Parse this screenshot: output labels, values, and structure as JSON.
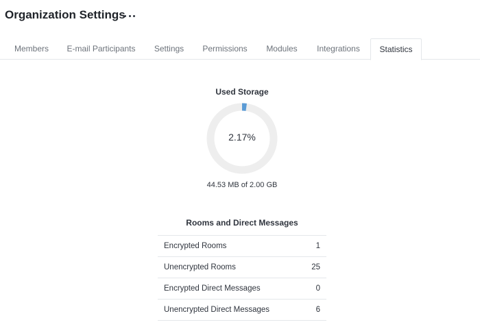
{
  "header": {
    "title": "Organization Settings",
    "more_icon": "more-horizontal-icon"
  },
  "tabs": [
    {
      "label": "Members",
      "active": false
    },
    {
      "label": "E-mail Participants",
      "active": false
    },
    {
      "label": "Settings",
      "active": false
    },
    {
      "label": "Permissions",
      "active": false
    },
    {
      "label": "Modules",
      "active": false
    },
    {
      "label": "Integrations",
      "active": false
    },
    {
      "label": "Statistics",
      "active": true
    }
  ],
  "storage": {
    "title": "Used Storage",
    "percent_label": "2.17%",
    "percent": 2.17,
    "caption": "44.53 MB of 2.00 GB",
    "colors": {
      "track": "#eeeeee",
      "fill": "#5b9bd5"
    }
  },
  "rooms": {
    "title": "Rooms and Direct Messages",
    "rows": [
      {
        "label": "Encrypted Rooms",
        "value": "1"
      },
      {
        "label": "Unencrypted Rooms",
        "value": "25"
      },
      {
        "label": "Encrypted Direct Messages",
        "value": "0"
      },
      {
        "label": "Unencrypted Direct Messages",
        "value": "6"
      }
    ]
  }
}
